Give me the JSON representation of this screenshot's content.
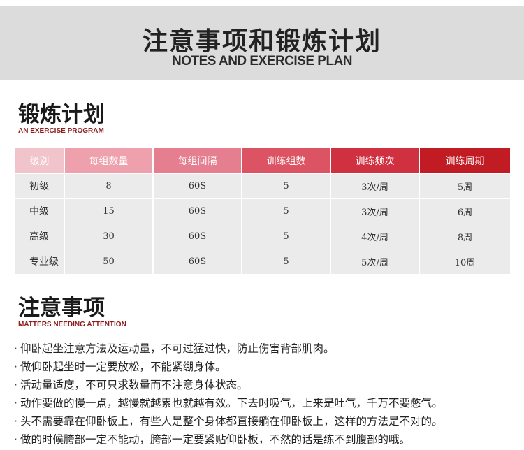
{
  "banner": {
    "title": "注意事项和锻炼计划",
    "subtitle": "NOTES AND EXERCISE PLAN"
  },
  "plan_section": {
    "title": "锻炼计划",
    "subtitle": "AN EXERCISE PROGRAM"
  },
  "table": {
    "header_colors": [
      "#f1c4cc",
      "#eea0ac",
      "#e57f8f",
      "#dc5464",
      "#cf3140",
      "#c11c24"
    ],
    "headers": [
      "级别",
      "每组数量",
      "每组间隔",
      "训练组数",
      "训练频次",
      "训练周期"
    ],
    "rows": [
      [
        "初级",
        "8",
        "60S",
        "5",
        "3次/周",
        "5周"
      ],
      [
        "中级",
        "15",
        "60S",
        "5",
        "3次/周",
        "6周"
      ],
      [
        "高级",
        "30",
        "60S",
        "5",
        "4次/周",
        "8周"
      ],
      [
        "专业级",
        "50",
        "60S",
        "5",
        "5次/周",
        "10周"
      ]
    ]
  },
  "notes_section": {
    "title": "注意事项",
    "subtitle": "MATTERS NEEDING ATTENTION",
    "bullet": "·",
    "items": [
      "仰卧起坐注意方法及运动量，不可过猛过快，防止伤害背部肌肉。",
      "做仰卧起坐时一定要放松，不能紧绷身体。",
      "活动量适度，不可只求数量而不注意身体状态。",
      "动作要做的慢一点，越慢就越累也就越有效。下去时吸气，上来是吐气，千万不要憋气。",
      "头不需要靠在仰卧板上，有些人是整个身体都直接躺在仰卧板上，这样的方法是不对的。",
      "做的时候胯部一定不能动，胯部一定要紧贴仰卧板，不然的话是练不到腹部的哦。"
    ]
  }
}
